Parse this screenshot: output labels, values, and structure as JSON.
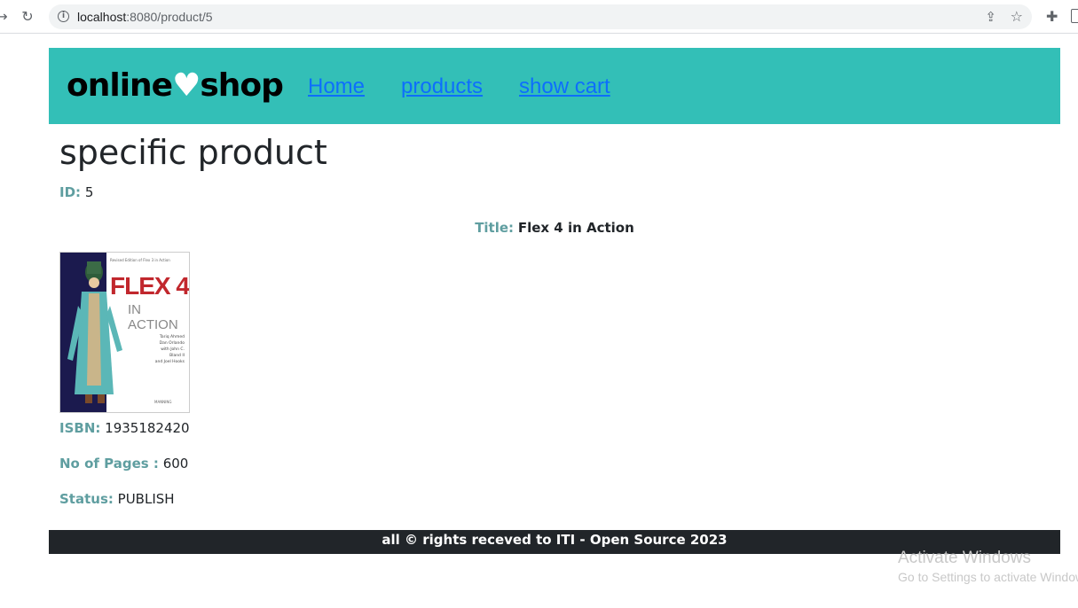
{
  "browser": {
    "url_host": "localhost",
    "url_rest": ":8080/product/5"
  },
  "navbar": {
    "brand_left": "online",
    "brand_heart": "♥",
    "brand_right": "shop",
    "links": [
      {
        "label": "Home"
      },
      {
        "label": "products"
      },
      {
        "label": "show cart"
      }
    ],
    "bg_color": "#33bfb7"
  },
  "product": {
    "heading": "specific product",
    "id_label": "ID:",
    "id_value": "5",
    "title_label": "Title:",
    "title_value": "Flex 4 in Action",
    "isbn_label": "ISBN:",
    "isbn_value": "1935182420",
    "pages_label": "No of Pages :",
    "pages_value": "600",
    "status_label": "Status:",
    "status_value": "PUBLISH",
    "cover": {
      "top_line": "Revised Edition of Flex 3 in Action",
      "title_big": "FLEX 4",
      "title_sub": "IN ACTION",
      "authors": [
        "Tariq Ahmed",
        "Dan Orlando",
        "with John C. Bland II",
        "and Joel Hooks"
      ],
      "publisher": "MANNING"
    }
  },
  "footer": {
    "text": "all © rights receved to ITI - Open Source 2023"
  },
  "watermark": {
    "line1": "Activate Windows",
    "line2": "Go to Settings to activate Windows."
  }
}
